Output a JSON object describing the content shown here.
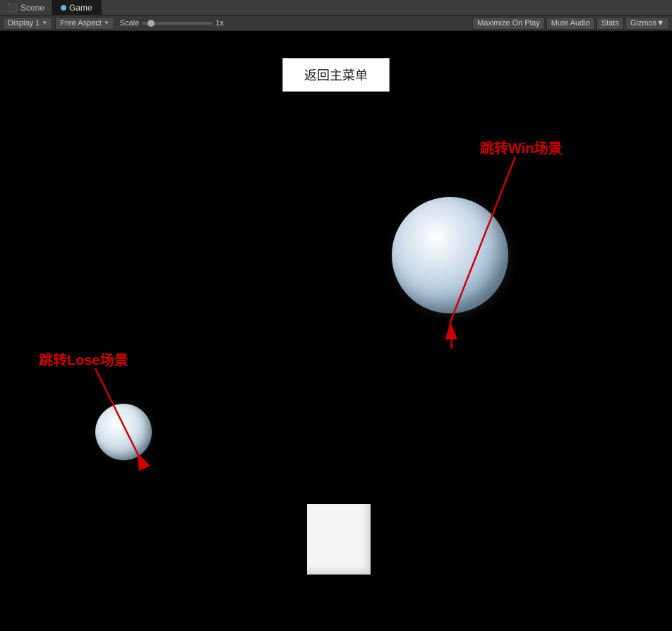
{
  "tabs": {
    "scene_label": "Scene",
    "game_label": "Game"
  },
  "toolbar": {
    "display_label": "Display 1",
    "aspect_label": "Free Aspect",
    "scale_label": "Scale",
    "scale_value": "1x",
    "maximize_on_play": "Maximize On Play",
    "mute_audio": "Mute Audio",
    "stats": "Stats",
    "gizmos": "Gizmos"
  },
  "game": {
    "return_button": "返回主�单",
    "label_win": "跳转Win场景",
    "label_lose": "跳转Lose场景"
  },
  "colors": {
    "accent_red": "#cc0000",
    "tab_active_bg": "#1a1a1a",
    "tab_inactive_bg": "#3c3c3c"
  }
}
